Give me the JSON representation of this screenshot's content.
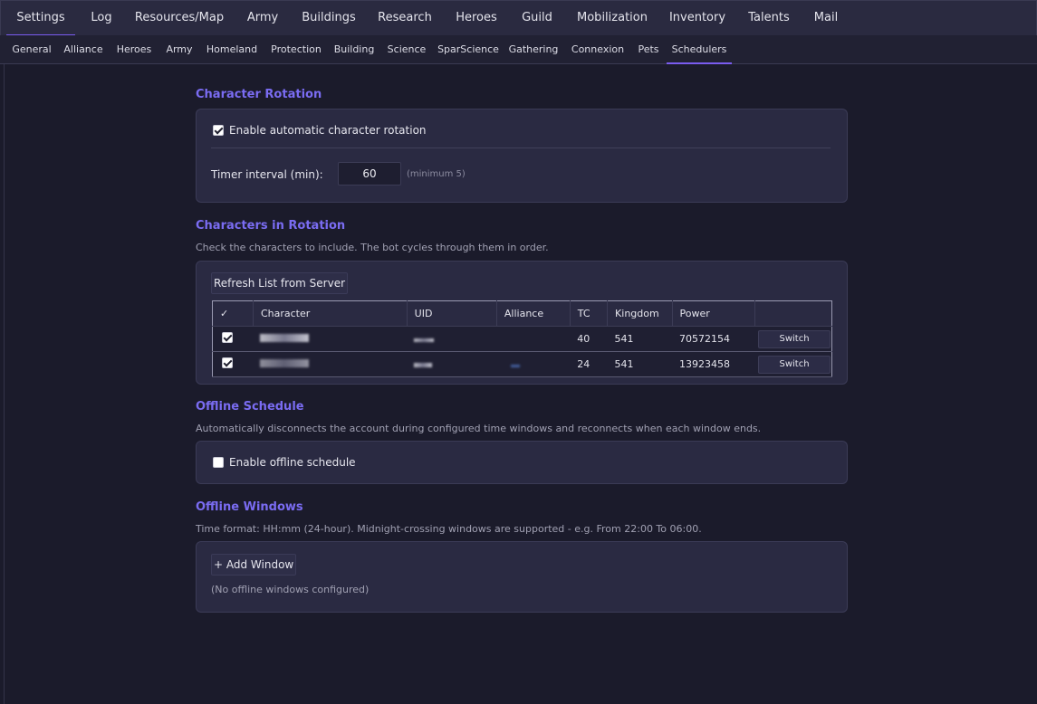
{
  "main_tabs": [
    {
      "label": "Settings"
    },
    {
      "label": "Log"
    },
    {
      "label": "Resources/Map"
    },
    {
      "label": "Army"
    },
    {
      "label": "Buildings"
    },
    {
      "label": "Research"
    },
    {
      "label": "Heroes"
    },
    {
      "label": "Guild"
    },
    {
      "label": "Mobilization"
    },
    {
      "label": "Inventory"
    },
    {
      "label": "Talents"
    },
    {
      "label": "Mail"
    }
  ],
  "sub_tabs": [
    {
      "label": "General"
    },
    {
      "label": "Alliance"
    },
    {
      "label": "Heroes"
    },
    {
      "label": "Army"
    },
    {
      "label": "Homeland"
    },
    {
      "label": "Protection"
    },
    {
      "label": "Building"
    },
    {
      "label": "Science"
    },
    {
      "label": "SparScience"
    },
    {
      "label": "Gathering"
    },
    {
      "label": "Connexion"
    },
    {
      "label": "Pets"
    },
    {
      "label": "Schedulers"
    }
  ],
  "character_rotation": {
    "title": "Character Rotation",
    "enable_label": "Enable automatic character rotation",
    "enabled": true,
    "timer_label": "Timer interval (min):",
    "timer_value": "60",
    "timer_hint": "(minimum 5)"
  },
  "characters": {
    "title": "Characters in Rotation",
    "description": "Check the characters to include. The bot cycles through them in order.",
    "refresh_label": "Refresh List from Server",
    "columns": [
      "✓",
      "Character",
      "UID",
      "Alliance",
      "TC",
      "Kingdom",
      "Power",
      ""
    ],
    "rows": [
      {
        "checked": true,
        "tc": "40",
        "kingdom": "541",
        "power": "70572154",
        "action": "Switch"
      },
      {
        "checked": true,
        "tc": "24",
        "kingdom": "541",
        "power": "13923458",
        "action": "Switch"
      }
    ]
  },
  "offline_schedule": {
    "title": "Offline Schedule",
    "description": "Automatically disconnects the account during configured time windows and reconnects when each window ends.",
    "enable_label": "Enable offline schedule",
    "enabled": false
  },
  "offline_windows": {
    "title": "Offline Windows",
    "description": "Time format: HH:mm (24-hour). Midnight-crossing windows are supported - e.g. From 22:00 To 06:00.",
    "add_label": "+ Add Window",
    "empty_text": "(No offline windows configured)"
  },
  "colors": {
    "accent": "#7a5cf0",
    "section_title": "#7a6cf2",
    "background": "#1b1b2b",
    "card": "#2a2a42"
  }
}
